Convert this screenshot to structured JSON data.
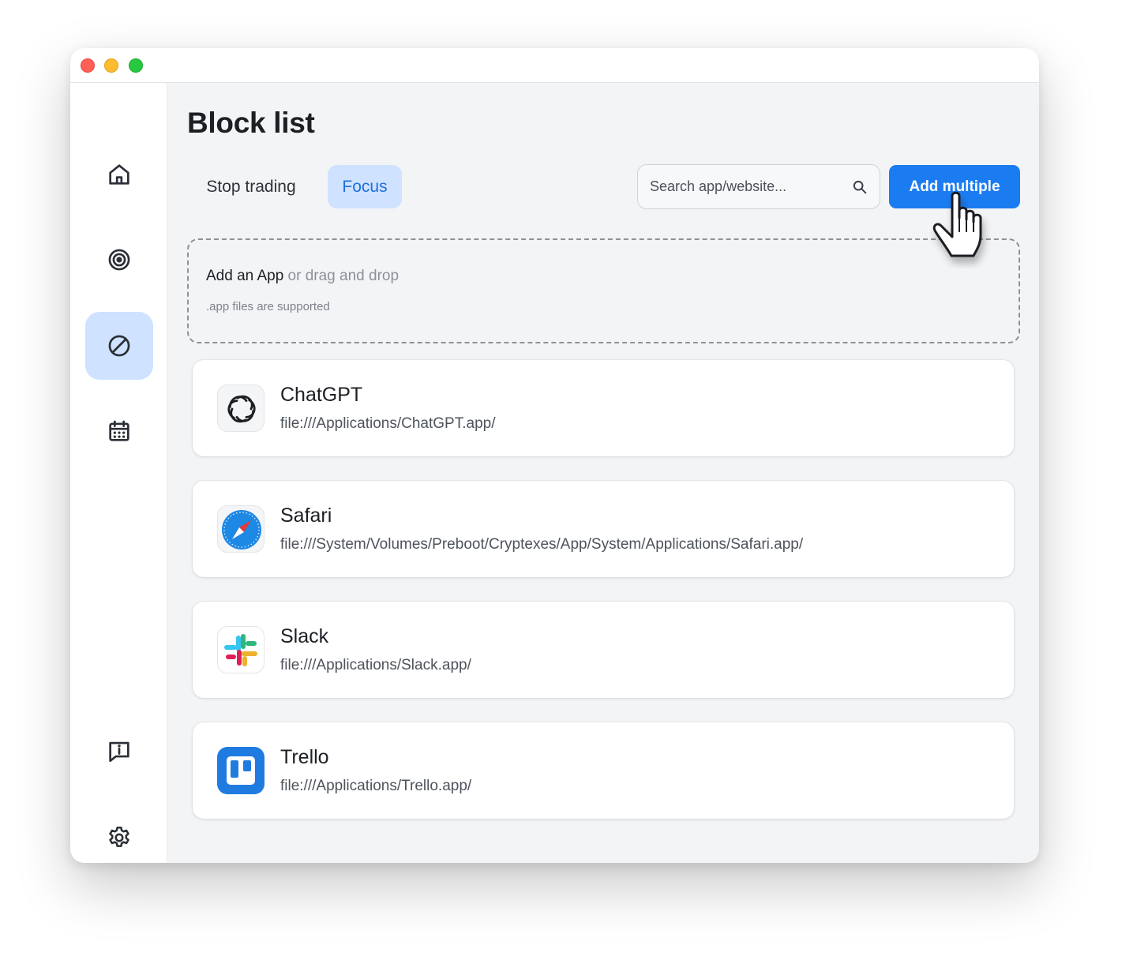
{
  "page": {
    "title": "Block list"
  },
  "sidebar": {
    "items": [
      {
        "name": "home",
        "icon": "home-icon",
        "active": false
      },
      {
        "name": "target",
        "icon": "target-icon",
        "active": false
      },
      {
        "name": "block",
        "icon": "block-icon",
        "active": true
      },
      {
        "name": "calendar",
        "icon": "calendar-icon",
        "active": false
      },
      {
        "name": "info",
        "icon": "info-icon",
        "active": false
      },
      {
        "name": "settings",
        "icon": "gear-icon",
        "active": false
      }
    ]
  },
  "tabs": [
    {
      "label": "Stop trading",
      "active": false
    },
    {
      "label": "Focus",
      "active": true
    }
  ],
  "search": {
    "placeholder": "Search app/website..."
  },
  "toolbar": {
    "add_multiple_label": "Add multiple"
  },
  "dropzone": {
    "title_strong": "Add an App",
    "title_muted": " or drag and drop",
    "subtitle": ".app files are supported"
  },
  "apps": [
    {
      "name": "ChatGPT",
      "path": "file:///Applications/ChatGPT.app/",
      "icon": "chatgpt-icon"
    },
    {
      "name": "Safari",
      "path": "file:///System/Volumes/Preboot/Cryptexes/App/System/Applications/Safari.app/",
      "icon": "safari-icon"
    },
    {
      "name": "Slack",
      "path": "file:///Applications/Slack.app/",
      "icon": "slack-icon"
    },
    {
      "name": "Trello",
      "path": "file:///Applications/Trello.app/",
      "icon": "trello-icon"
    }
  ],
  "colors": {
    "accent": "#1b7cf2",
    "active_tab_bg": "#cfe2ff",
    "active_tab_text": "#1f6fdc",
    "window_bg": "#f3f4f6"
  }
}
